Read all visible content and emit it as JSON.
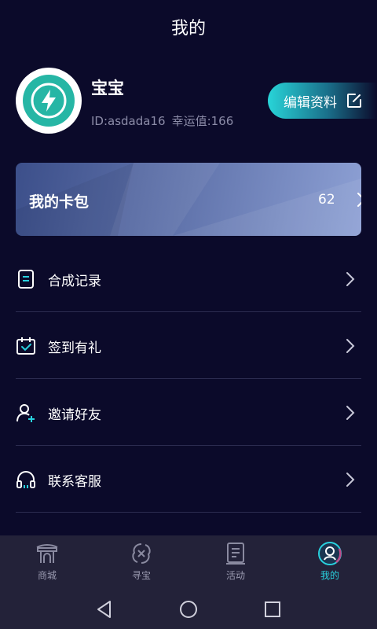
{
  "header": {
    "title": "我的"
  },
  "profile": {
    "avatar_icon": "lightning-icon",
    "name": "宝宝",
    "id_text": "ID:asdada16",
    "luck_text": "幸运值:166",
    "edit_label": "编辑资料"
  },
  "wallet": {
    "label": "我的卡包",
    "count": "62"
  },
  "menu": {
    "items": [
      {
        "label": "合成记录",
        "icon": "document-icon"
      },
      {
        "label": "签到有礼",
        "icon": "calendar-check-icon"
      },
      {
        "label": "邀请好友",
        "icon": "add-user-icon"
      },
      {
        "label": "联系客服",
        "icon": "headset-icon"
      }
    ]
  },
  "tabbar": {
    "tabs": [
      {
        "label": "商城",
        "icon": "shop-icon",
        "active": false
      },
      {
        "label": "寻宝",
        "icon": "treasure-icon",
        "active": false
      },
      {
        "label": "活动",
        "icon": "activity-icon",
        "active": false
      },
      {
        "label": "我的",
        "icon": "profile-icon",
        "active": true
      }
    ]
  },
  "colors": {
    "background": "#0b0a2a",
    "accent": "#29d1de",
    "avatar": "#26b6a5",
    "tabbar": "#232239"
  }
}
